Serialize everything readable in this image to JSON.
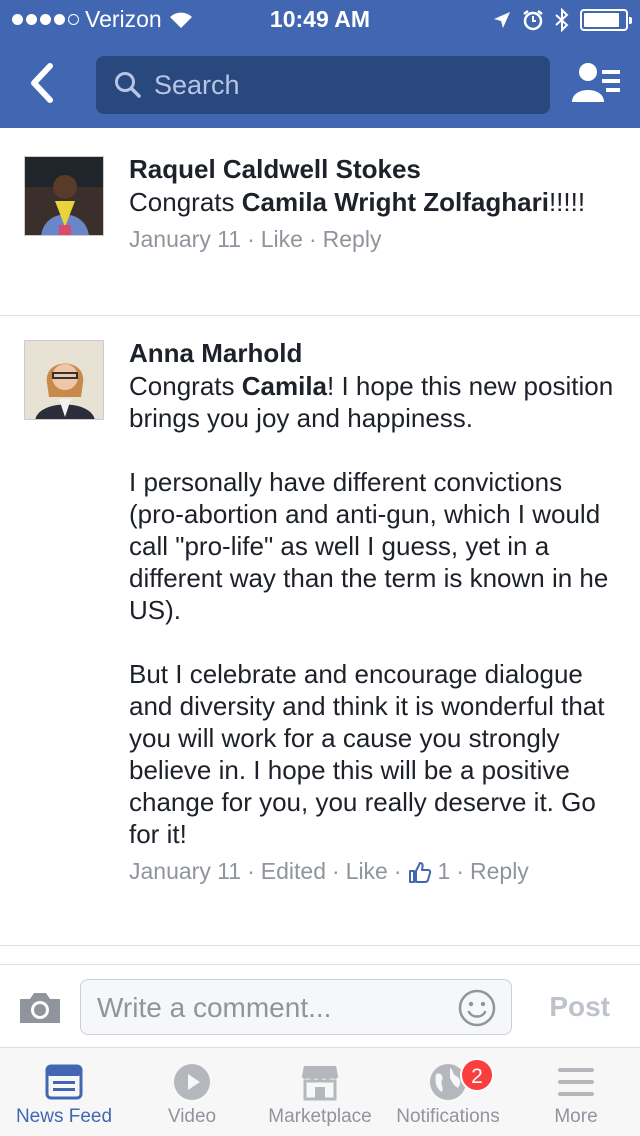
{
  "status_bar": {
    "carrier": "Verizon",
    "time": "10:49 AM"
  },
  "nav": {
    "search_placeholder": "Search"
  },
  "comments": [
    {
      "author": "Raquel Caldwell Stokes",
      "text_before": "Congrats ",
      "mention": "Camila Wright Zolfaghari",
      "text_after": "!!!!!",
      "date": "January 11",
      "like": "Like",
      "reply": "Reply"
    },
    {
      "author": "Anna Marhold",
      "text_before": "Congrats ",
      "mention": "Camila",
      "text_after": "! I hope this new position brings you joy and happiness.\n\nI personally have different convictions (pro-abortion and anti-gun, which I would call \"pro-life\" as well I guess, yet in a different way than the term is known in he US).\n\nBut I celebrate and encourage dialogue and diversity and think it is wonderful that you will work for a cause you strongly believe in. I hope this will be a positive change for you, you really deserve it. Go for it!",
      "date": "January 11",
      "edited": "Edited",
      "like": "Like",
      "like_count": "1",
      "reply": "Reply"
    }
  ],
  "composer": {
    "placeholder": "Write a comment...",
    "post_label": "Post"
  },
  "tabs": [
    {
      "label": "News Feed",
      "icon": "news-feed-icon",
      "active": true
    },
    {
      "label": "Video",
      "icon": "video-icon"
    },
    {
      "label": "Marketplace",
      "icon": "marketplace-icon"
    },
    {
      "label": "Notifications",
      "icon": "globe-icon",
      "badge": "2"
    },
    {
      "label": "More",
      "icon": "menu-icon"
    }
  ],
  "colors": {
    "brand": "#4267b2",
    "badge": "#fa3e3e"
  }
}
